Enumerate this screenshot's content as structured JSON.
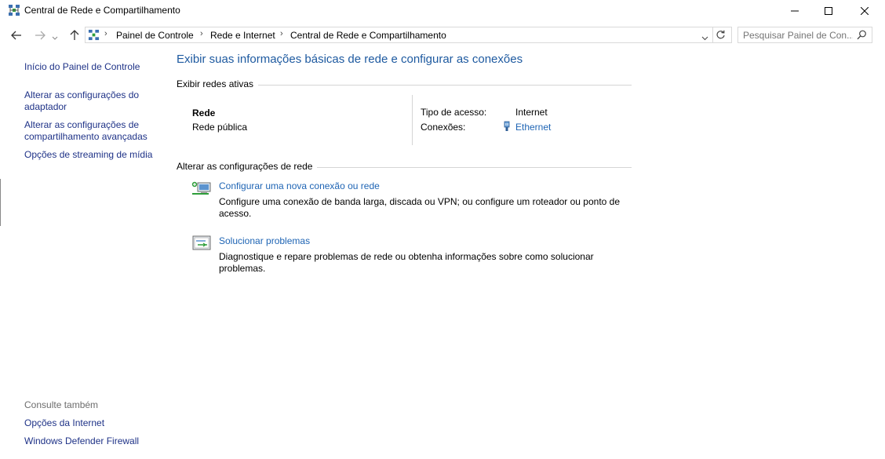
{
  "window": {
    "title": "Central de Rede e Compartilhamento",
    "controls": {
      "minimize": "—",
      "maximize": "☐",
      "close": "✕"
    }
  },
  "nav": {
    "back_icon": "arrow-left-icon",
    "forward_icon": "arrow-right-icon",
    "up_icon": "arrow-up-icon"
  },
  "address": {
    "breadcrumbs": [
      "Painel de Controle",
      "Rede e Internet",
      "Central de Rede e Compartilhamento"
    ]
  },
  "search": {
    "placeholder": "Pesquisar Painel de Con..."
  },
  "sidebar": {
    "links": [
      "Início do Painel de Controle",
      "Alterar as configurações do\nadaptador",
      "Alterar as configurações de\ncompartilhamento avançadas",
      "Opções de streaming de mídia"
    ],
    "see_also_heading": "Consulte também",
    "see_also": [
      "Opções da Internet",
      "Windows Defender Firewall"
    ]
  },
  "main": {
    "title": "Exibir suas informações básicas de rede e configurar as conexões",
    "active_networks_label": "Exibir redes ativas",
    "network": {
      "name": "Rede",
      "type": "Rede pública",
      "access_type_label": "Tipo de acesso:",
      "access_type_value": "Internet",
      "connections_label": "Conexões:",
      "connections_value": "Ethernet"
    },
    "change_settings_label": "Alterar as configurações de rede",
    "tasks": [
      {
        "title": "Configurar uma nova conexão ou rede",
        "description": "Configure uma conexão de banda larga, discada ou VPN; ou configure um roteador ou ponto de acesso."
      },
      {
        "title": "Solucionar problemas",
        "description": "Diagnostique e repare problemas de rede ou obtenha informações sobre como solucionar problemas."
      }
    ]
  }
}
